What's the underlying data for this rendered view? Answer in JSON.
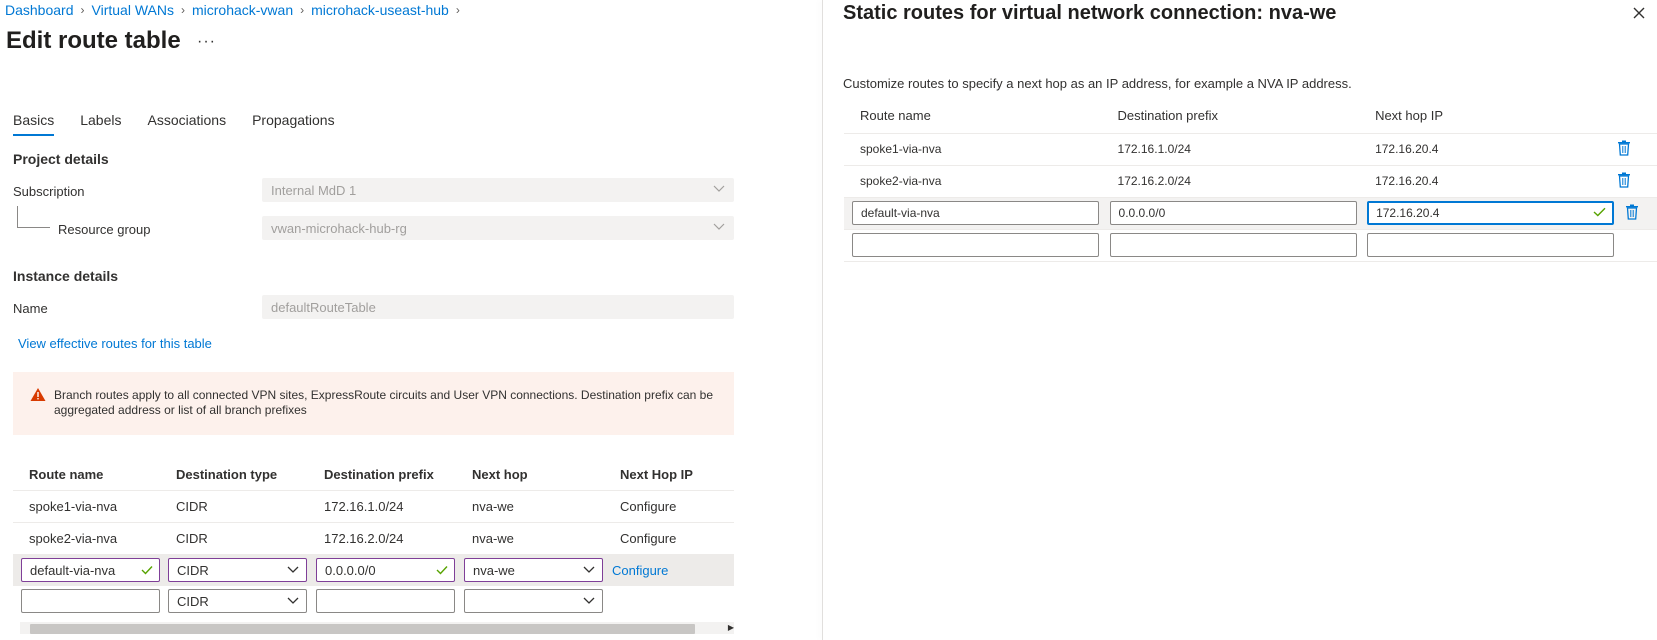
{
  "breadcrumb": [
    "Dashboard",
    "Virtual WANs",
    "microhack-vwan",
    "microhack-useast-hub"
  ],
  "page_title": "Edit route table",
  "more_label": "···",
  "tabs": [
    "Basics",
    "Labels",
    "Associations",
    "Propagations"
  ],
  "active_tab": "Basics",
  "project_details": {
    "heading": "Project details",
    "subscription_label": "Subscription",
    "subscription_value": "Internal MdD 1",
    "resource_group_label": "Resource group",
    "resource_group_value": "vwan-microhack-hub-rg"
  },
  "instance_details": {
    "heading": "Instance details",
    "name_label": "Name",
    "name_value": "defaultRouteTable"
  },
  "effective_routes_link": "View effective routes for this table",
  "warning_text": "Branch routes apply to all connected VPN sites, ExpressRoute circuits and User VPN connections. Destination prefix can be aggregated address or list of all branch prefixes",
  "routes_table": {
    "headers": [
      "Route name",
      "Destination type",
      "Destination prefix",
      "Next hop",
      "Next Hop IP"
    ],
    "rows": [
      {
        "name": "spoke1-via-nva",
        "type": "CIDR",
        "prefix": "172.16.1.0/24",
        "next_hop": "nva-we",
        "next_hop_ip": "Configure"
      },
      {
        "name": "spoke2-via-nva",
        "type": "CIDR",
        "prefix": "172.16.2.0/24",
        "next_hop": "nva-we",
        "next_hop_ip": "Configure"
      }
    ],
    "edit_row": {
      "name": "default-via-nva",
      "type": "CIDR",
      "prefix": "0.0.0.0/0",
      "next_hop": "nva-we",
      "next_hop_ip": "Configure"
    },
    "new_row": {
      "name": "",
      "type": "CIDR",
      "prefix": "",
      "next_hop": ""
    }
  },
  "static_blade": {
    "title": "Static routes for virtual network connection: nva-we",
    "description": "Customize routes to specify a next hop as an IP address, for example a NVA IP address.",
    "headers": [
      "Route name",
      "Destination prefix",
      "Next hop IP"
    ],
    "rows": [
      {
        "name": "spoke1-via-nva",
        "prefix": "172.16.1.0/24",
        "next_hop_ip": "172.16.20.4"
      },
      {
        "name": "spoke2-via-nva",
        "prefix": "172.16.2.0/24",
        "next_hop_ip": "172.16.20.4"
      }
    ],
    "edit_row": {
      "name": "default-via-nva",
      "prefix": "0.0.0.0/0",
      "next_hop_ip": "172.16.20.4"
    },
    "new_row": {
      "name": "",
      "prefix": "",
      "next_hop_ip": ""
    }
  },
  "colors": {
    "accent": "#0078d4",
    "warning_bg": "#fdf1ec",
    "warning_icon": "#d83b01",
    "valid": "#57a300"
  }
}
